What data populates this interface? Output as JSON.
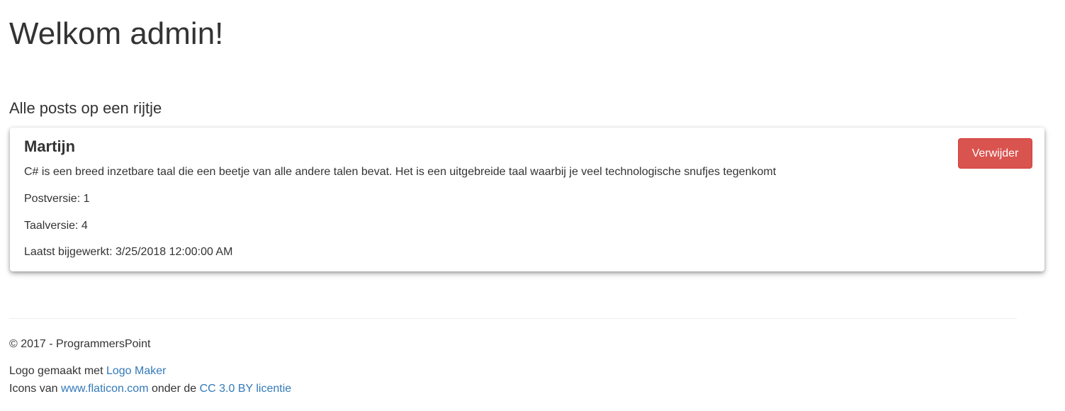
{
  "header": {
    "title": "Welkom admin!"
  },
  "section": {
    "title": "Alle posts op een rijtje"
  },
  "post": {
    "author": "Martijn",
    "content": "C# is een breed inzetbare taal die een beetje van alle andere talen bevat. Het is een uitgebreide taal waarbij je veel technologische snufjes tegenkomt",
    "version": "Postversie: 1",
    "language_version": "Taalversie: 4",
    "last_updated": "Laatst bijgewerkt: 3/25/2018 12:00:00 AM",
    "delete_label": "Verwijder"
  },
  "footer": {
    "copyright": "© 2017 - ProgrammersPoint",
    "logo_prefix": "Logo gemaakt met ",
    "logo_link": "Logo Maker",
    "icons_prefix": "Icons van ",
    "icons_link": "www.flaticon.com",
    "icons_middle": " onder de ",
    "license_link": "CC 3.0 BY licentie"
  },
  "colors": {
    "danger": "#d9534f",
    "link": "#337ab7",
    "text": "#333333"
  }
}
